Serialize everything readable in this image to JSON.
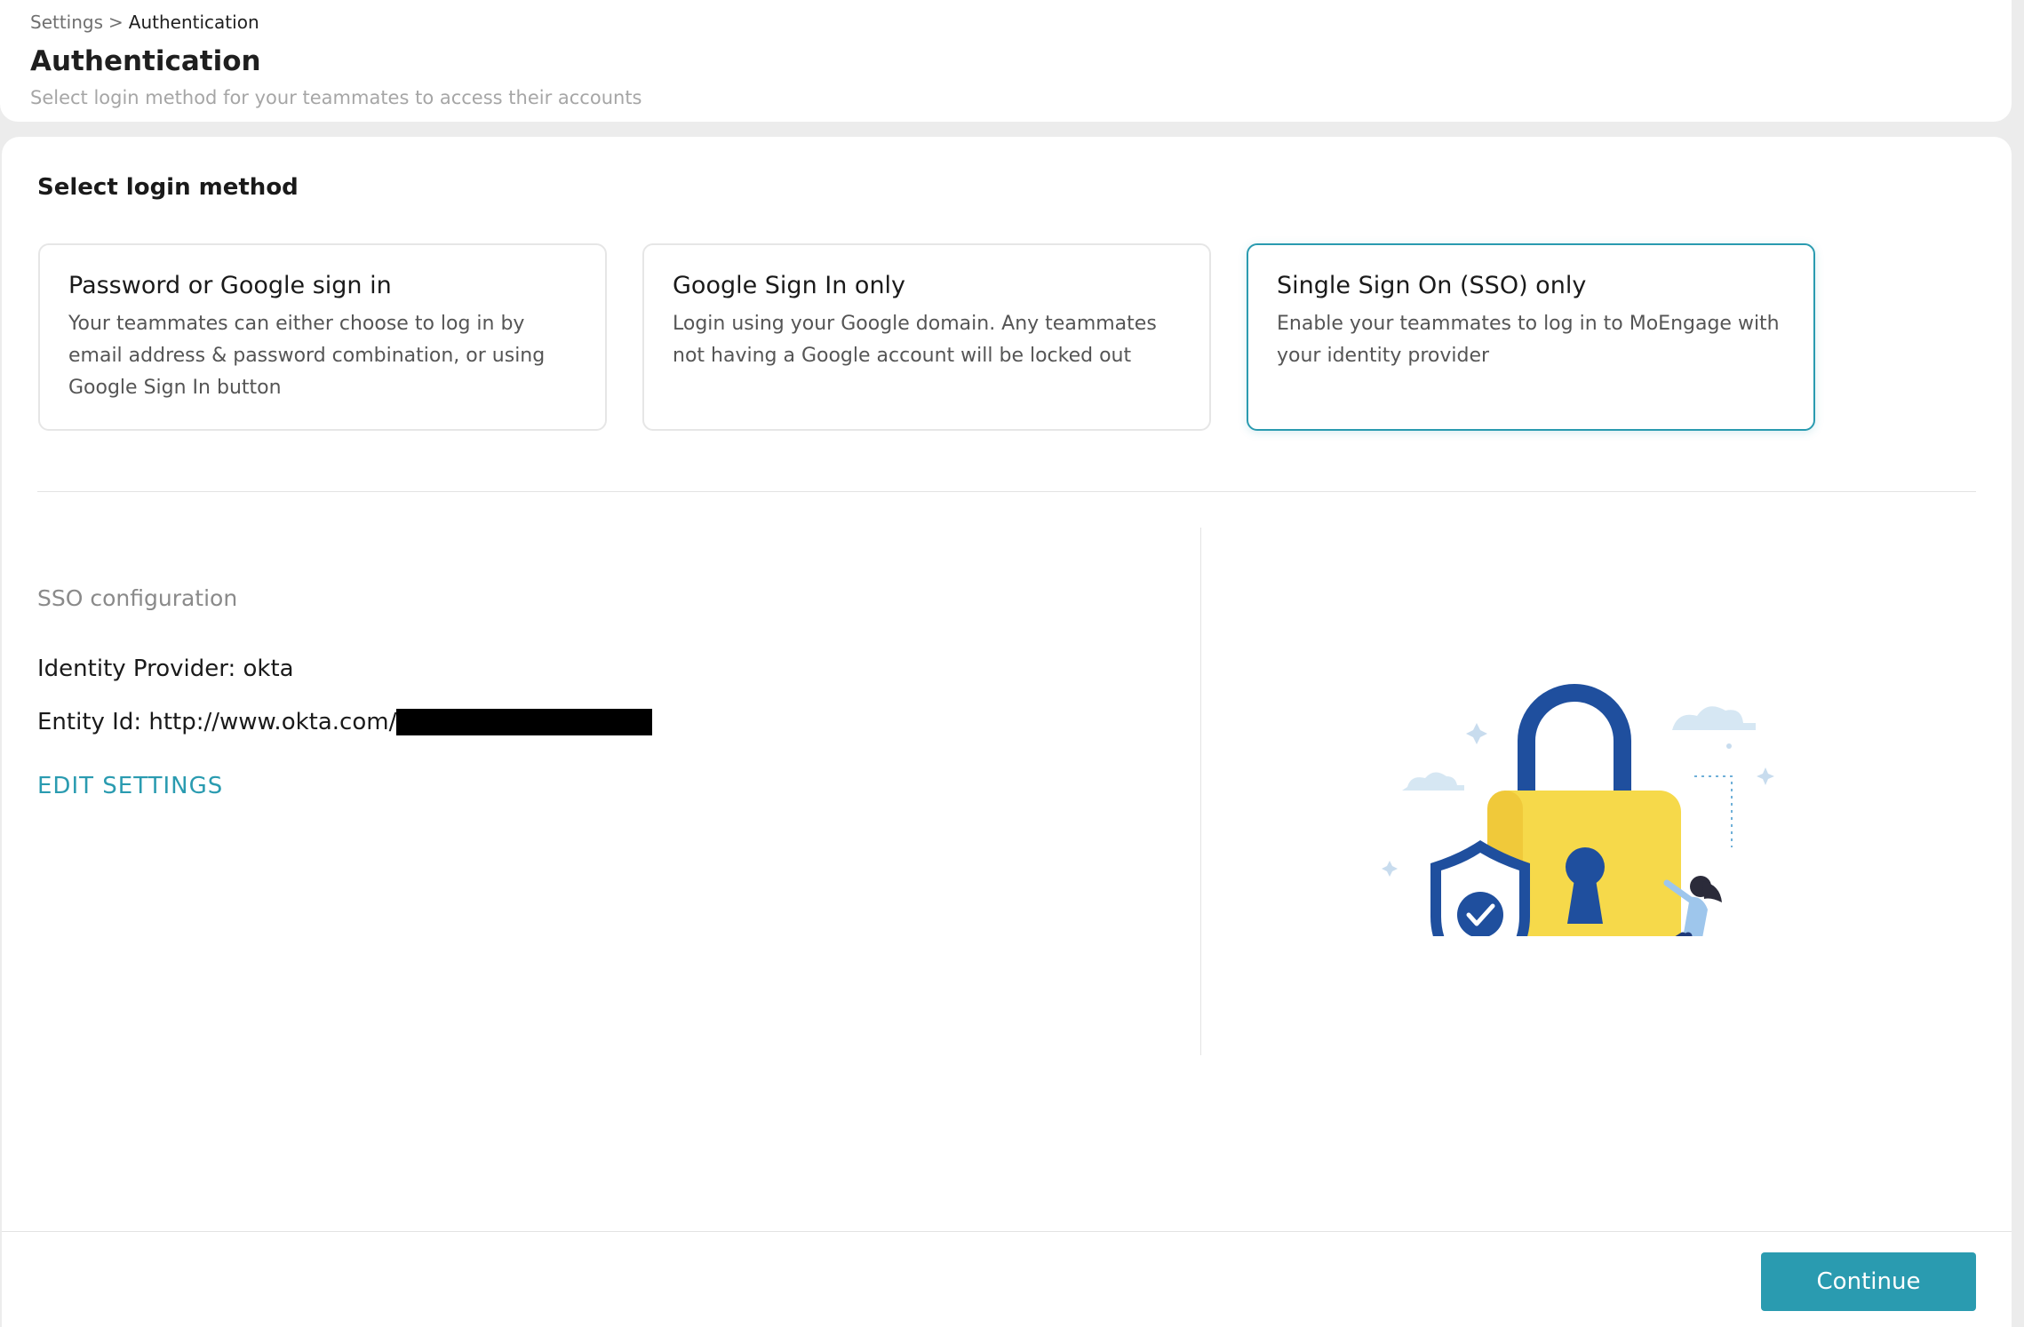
{
  "breadcrumb": {
    "root": "Settings",
    "separator": ">",
    "current": "Authentication"
  },
  "header": {
    "title": "Authentication",
    "subtitle": "Select login method for your teammates to access their accounts"
  },
  "login_method": {
    "section_title": "Select login method",
    "selected": "sso",
    "options": [
      {
        "id": "password",
        "title": "Password or Google sign in",
        "description": "Your teammates can either choose to log in by email address & password combination, or using Google Sign In button"
      },
      {
        "id": "google",
        "title": "Google Sign In only",
        "description": "Login using your Google domain. Any teammates not having a Google account will be locked out"
      },
      {
        "id": "sso",
        "title": "Single Sign On (SSO) only",
        "description": "Enable your teammates to log in to MoEngage with your identity provider"
      }
    ]
  },
  "sso_config": {
    "title": "SSO configuration",
    "identity_provider": "Identity Provider: okta",
    "entity_id": "Entity Id: http://www.okta.com/",
    "edit_label": "EDIT SETTINGS"
  },
  "footer": {
    "continue_label": "Continue"
  },
  "colors": {
    "accent": "#2a9bb0",
    "lock_yellow": "#f6d94a",
    "lock_blue": "#1f4f9e"
  }
}
